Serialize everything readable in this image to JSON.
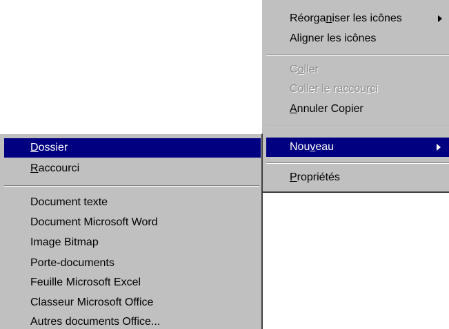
{
  "context_menu": {
    "reorganiser": {
      "pre": "Réorga",
      "key": "n",
      "post": "iser les icônes"
    },
    "aligner": {
      "pre": "Aligner les icônes",
      "key": "",
      "post": ""
    },
    "coller": {
      "pre": "C",
      "key": "o",
      "post": "ller"
    },
    "coller_raccourci": {
      "pre": "Coller le raccou",
      "key": "r",
      "post": "ci"
    },
    "annuler": {
      "pre": "",
      "key": "A",
      "post": "nnuler Copier"
    },
    "nouveau": {
      "pre": "Nou",
      "key": "v",
      "post": "eau"
    },
    "proprietes": {
      "pre": "",
      "key": "P",
      "post": "ropriétés"
    }
  },
  "submenu": {
    "dossier": {
      "pre": "",
      "key": "D",
      "post": "ossier"
    },
    "raccourci": {
      "pre": "",
      "key": "R",
      "post": "accourci"
    },
    "documents": [
      "Document texte",
      "Document Microsoft Word",
      "Image Bitmap",
      "Porte-documents",
      "Feuille Microsoft Excel",
      "Classeur Microsoft Office",
      "Autres documents Office..."
    ]
  },
  "colors": {
    "menu_bg": "#c0c0c0",
    "highlight_bg": "#000080",
    "highlight_text": "#ffffff",
    "disabled_text": "#8a8a8a"
  }
}
